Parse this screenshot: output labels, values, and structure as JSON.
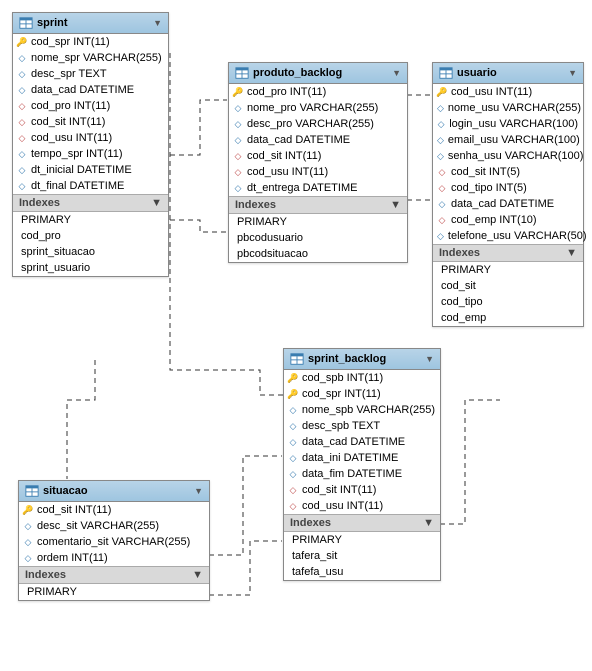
{
  "tables": {
    "sprint": {
      "title": "sprint",
      "fields": [
        {
          "k": "pk",
          "name": "cod_spr",
          "type": "INT(11)"
        },
        {
          "k": "col",
          "name": "nome_spr",
          "type": "VARCHAR(255)"
        },
        {
          "k": "col",
          "name": "desc_spr",
          "type": "TEXT"
        },
        {
          "k": "col",
          "name": "data_cad",
          "type": "DATETIME"
        },
        {
          "k": "fk",
          "name": "cod_pro",
          "type": "INT(11)"
        },
        {
          "k": "fk",
          "name": "cod_sit",
          "type": "INT(11)"
        },
        {
          "k": "fk",
          "name": "cod_usu",
          "type": "INT(11)"
        },
        {
          "k": "col",
          "name": "tempo_spr",
          "type": "INT(11)"
        },
        {
          "k": "col",
          "name": "dt_inicial",
          "type": "DATETIME"
        },
        {
          "k": "col",
          "name": "dt_final",
          "type": "DATETIME"
        }
      ],
      "indexes_label": "Indexes",
      "indexes": [
        "PRIMARY",
        "cod_pro",
        "sprint_situacao",
        "sprint_usuario"
      ]
    },
    "produto_backlog": {
      "title": "produto_backlog",
      "fields": [
        {
          "k": "pk",
          "name": "cod_pro",
          "type": "INT(11)"
        },
        {
          "k": "col",
          "name": "nome_pro",
          "type": "VARCHAR(255)"
        },
        {
          "k": "col",
          "name": "desc_pro",
          "type": "VARCHAR(255)"
        },
        {
          "k": "col",
          "name": "data_cad",
          "type": "DATETIME"
        },
        {
          "k": "fk",
          "name": "cod_sit",
          "type": "INT(11)"
        },
        {
          "k": "fk",
          "name": "cod_usu",
          "type": "INT(11)"
        },
        {
          "k": "col",
          "name": "dt_entrega",
          "type": "DATETIME"
        }
      ],
      "indexes_label": "Indexes",
      "indexes": [
        "PRIMARY",
        "pbcodusuario",
        "pbcodsituacao"
      ]
    },
    "usuario": {
      "title": "usuario",
      "fields": [
        {
          "k": "pk",
          "name": "cod_usu",
          "type": "INT(11)"
        },
        {
          "k": "col",
          "name": "nome_usu",
          "type": "VARCHAR(255)"
        },
        {
          "k": "col",
          "name": "login_usu",
          "type": "VARCHAR(100)"
        },
        {
          "k": "col",
          "name": "email_usu",
          "type": "VARCHAR(100)"
        },
        {
          "k": "col",
          "name": "senha_usu",
          "type": "VARCHAR(100)"
        },
        {
          "k": "fk",
          "name": "cod_sit",
          "type": "INT(5)"
        },
        {
          "k": "fk",
          "name": "cod_tipo",
          "type": "INT(5)"
        },
        {
          "k": "col",
          "name": "data_cad",
          "type": "DATETIME"
        },
        {
          "k": "fk",
          "name": "cod_emp",
          "type": "INT(10)"
        },
        {
          "k": "col",
          "name": "telefone_usu",
          "type": "VARCHAR(50)"
        }
      ],
      "indexes_label": "Indexes",
      "indexes": [
        "PRIMARY",
        "cod_sit",
        "cod_tipo",
        "cod_emp"
      ]
    },
    "sprint_backlog": {
      "title": "sprint_backlog",
      "fields": [
        {
          "k": "pk",
          "name": "cod_spb",
          "type": "INT(11)"
        },
        {
          "k": "pk",
          "name": "cod_spr",
          "type": "INT(11)"
        },
        {
          "k": "col",
          "name": "nome_spb",
          "type": "VARCHAR(255)"
        },
        {
          "k": "col",
          "name": "desc_spb",
          "type": "TEXT"
        },
        {
          "k": "col",
          "name": "data_cad",
          "type": "DATETIME"
        },
        {
          "k": "col",
          "name": "data_ini",
          "type": "DATETIME"
        },
        {
          "k": "col",
          "name": "data_fim",
          "type": "DATETIME"
        },
        {
          "k": "fk",
          "name": "cod_sit",
          "type": "INT(11)"
        },
        {
          "k": "fk",
          "name": "cod_usu",
          "type": "INT(11)"
        }
      ],
      "indexes_label": "Indexes",
      "indexes": [
        "PRIMARY",
        "tafera_sit",
        "tafefa_usu"
      ]
    },
    "situacao": {
      "title": "situacao",
      "fields": [
        {
          "k": "pk",
          "name": "cod_sit",
          "type": "INT(11)"
        },
        {
          "k": "col",
          "name": "desc_sit",
          "type": "VARCHAR(255)"
        },
        {
          "k": "col",
          "name": "comentario_sit",
          "type": "VARCHAR(255)"
        },
        {
          "k": "col",
          "name": "ordem",
          "type": "INT(11)"
        }
      ],
      "indexes_label": "Indexes",
      "indexes": [
        "PRIMARY"
      ]
    }
  },
  "caret": "▼"
}
